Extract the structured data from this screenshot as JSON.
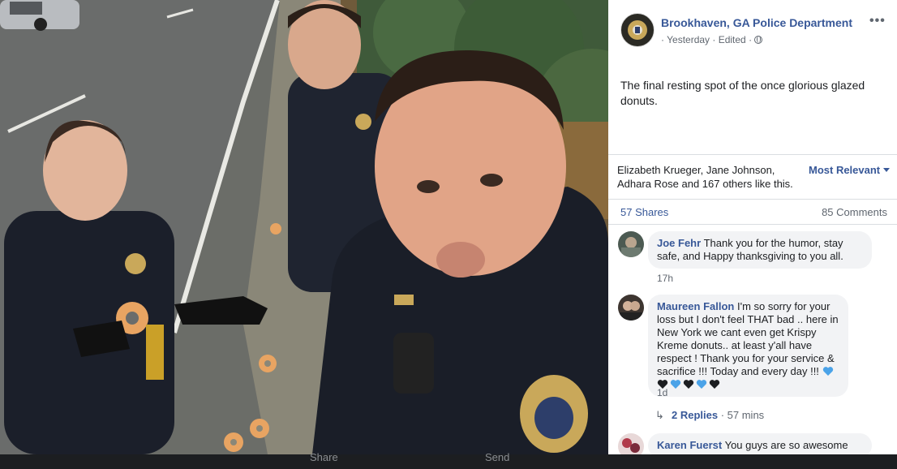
{
  "photo": {
    "toolbar": {
      "share_label": "Share",
      "send_label": "Send"
    }
  },
  "post": {
    "page_name": "Brookhaven, GA Police Department",
    "meta": "· Yesterday · Edited ·",
    "body": "The final resting spot of the once glorious glazed donuts.",
    "likes": "Elizabeth Krueger, Jane Johnson, Adhara Rose and 167 others like this.",
    "sort_label": "Most Relevant",
    "shares": "57 Shares",
    "comments_count": "85 Comments"
  },
  "comments": [
    {
      "author": "Joe Fehr",
      "text": "Thank you for the humor, stay safe, and Happy thanksgiving to you all.",
      "time": "17h"
    },
    {
      "author": "Maureen Fallon",
      "text": "I'm so sorry for your loss but I don't feel THAT bad .. here in New York we cant even get Krispy Kreme donuts.. at least y'all have respect ! Thank you for your service & sacrifice !!! Today and every day !!!",
      "emojis": [
        "blue-heart",
        "black-heart",
        "blue-heart",
        "black-heart",
        "blue-heart",
        "black-heart"
      ],
      "time": "1d",
      "replies_link": "2 Replies",
      "replies_meta": "· 57 mins"
    },
    {
      "author": "Karen Fuerst",
      "text": "You guys are so awesome"
    }
  ],
  "colors": {
    "link": "#385898",
    "muted": "#606770",
    "bubble": "#f2f3f5",
    "blue_heart": "#4ba3e8",
    "black_heart": "#1c1e21"
  }
}
